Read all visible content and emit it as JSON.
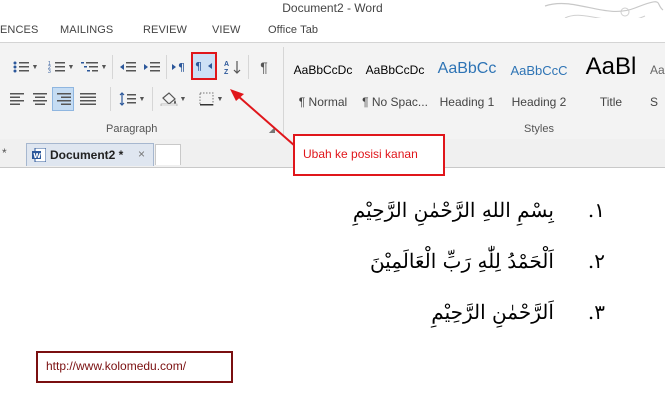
{
  "window": {
    "title": "Document2 - Word"
  },
  "ribbon_tabs": [
    "ENCES",
    "MAILINGS",
    "REVIEW",
    "VIEW",
    "Office Tab"
  ],
  "ribbon": {
    "paragraph_group_label": "Paragraph",
    "styles_group_label": "Styles",
    "styles": [
      {
        "sample": "AaBbCcDc",
        "name": "¶ Normal"
      },
      {
        "sample": "AaBbCcDc",
        "name": "¶ No Spac..."
      },
      {
        "sample": "AaBbCc",
        "name": "Heading 1"
      },
      {
        "sample": "AaBbCcC",
        "name": "Heading 2"
      },
      {
        "sample": "AaBl",
        "name": "Title"
      },
      {
        "sample": "Aa",
        "name": "S"
      }
    ]
  },
  "document_tabs": {
    "active": "Document2 *",
    "left_fragment": "*",
    "close_glyph": "×"
  },
  "document": {
    "lines": [
      {
        "num": "١.",
        "text": "بِسْمِ اللهِ الرَّحْمٰنِ الرَّحِيْمِ"
      },
      {
        "num": "٢.",
        "text": "اَلْحَمْدُ لِلّٰهِ رَبِّ الْعَالَمِيْنَ"
      },
      {
        "num": "٣.",
        "text": "اَلرَّحْمٰنِ الرَّحِيْمِ"
      }
    ]
  },
  "annotations": {
    "callout": "Ubah ke posisi kanan",
    "url": "http://www.kolomedu.com/",
    "highlight_color": "#e0161b",
    "url_color": "#7a0f10"
  }
}
